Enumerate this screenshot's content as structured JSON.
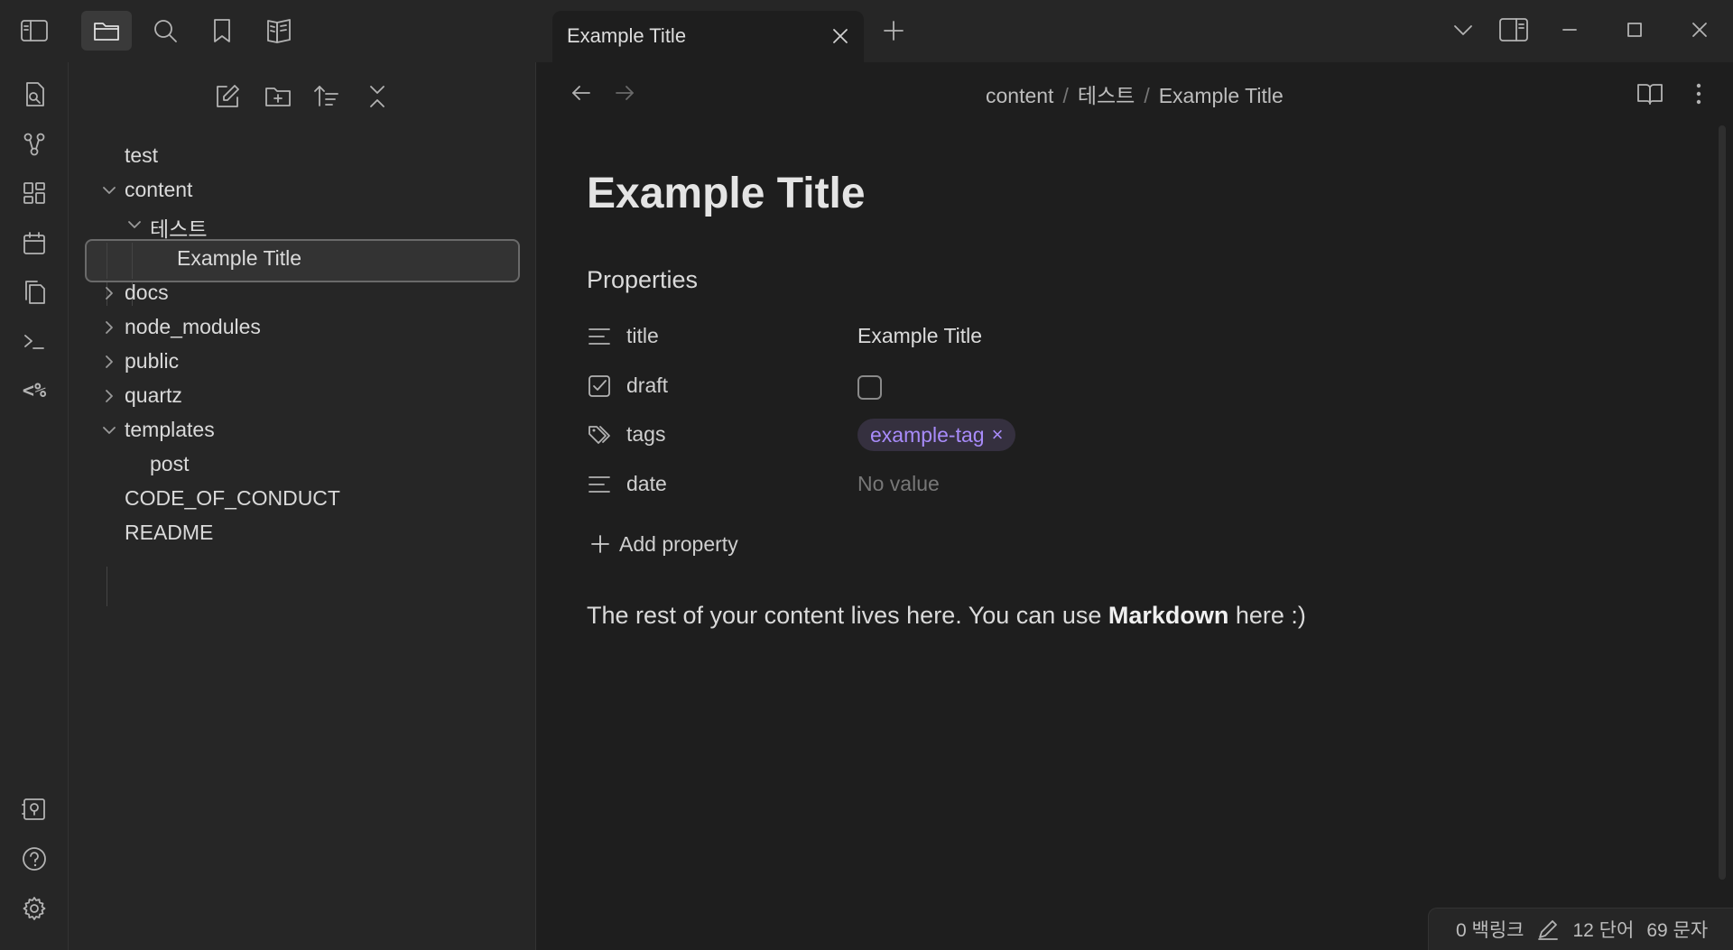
{
  "titlebar": {
    "tab_title": "Example Title",
    "icons": [
      "sidebar-toggle-icon",
      "folder-icon",
      "search-icon",
      "bookmark-icon",
      "book-icon",
      "chevron-down-icon",
      "split-view-icon",
      "minimize-icon",
      "maximize-icon",
      "close-icon"
    ]
  },
  "ribbon": {
    "templater_label": "<%",
    "icons": [
      "open-note-icon",
      "graph-icon",
      "dashboard-icon",
      "calendar-icon",
      "copy-icon",
      "terminal-icon",
      "vault-icon",
      "help-icon",
      "settings-icon"
    ]
  },
  "sidebar": {
    "toolbar_icons": [
      "new-note-icon",
      "new-folder-icon",
      "sort-icon",
      "collapse-all-icon"
    ],
    "tree": [
      {
        "label": "test",
        "indent": 0,
        "chevron": "none"
      },
      {
        "label": "content",
        "indent": 0,
        "chevron": "down"
      },
      {
        "label": "테스트",
        "indent": 1,
        "chevron": "down"
      },
      {
        "label": "Example Title",
        "indent": 2,
        "chevron": "none",
        "selected": true
      },
      {
        "label": "docs",
        "indent": 0,
        "chevron": "right"
      },
      {
        "label": "node_modules",
        "indent": 0,
        "chevron": "right"
      },
      {
        "label": "public",
        "indent": 0,
        "chevron": "right"
      },
      {
        "label": "quartz",
        "indent": 0,
        "chevron": "right"
      },
      {
        "label": "templates",
        "indent": 0,
        "chevron": "down"
      },
      {
        "label": "post",
        "indent": 1,
        "chevron": "none"
      },
      {
        "label": "CODE_OF_CONDUCT",
        "indent": 0,
        "chevron": "none"
      },
      {
        "label": "README",
        "indent": 0,
        "chevron": "none"
      }
    ]
  },
  "main": {
    "breadcrumb": [
      "content",
      "테스트",
      "Example Title"
    ],
    "breadcrumb_sep": "/",
    "title": "Example Title",
    "properties_heading": "Properties",
    "properties": [
      {
        "key": "title",
        "type": "text",
        "value": "Example Title"
      },
      {
        "key": "draft",
        "type": "checkbox",
        "value": false
      },
      {
        "key": "tags",
        "type": "tags",
        "value": "example-tag"
      },
      {
        "key": "date",
        "type": "text",
        "value": "No value"
      }
    ],
    "tag_remove": "×",
    "add_property": "Add property",
    "body": {
      "before": "The rest of your content lives here. You can use ",
      "bold": "Markdown",
      "after": " here :)"
    }
  },
  "statusbar": {
    "backlinks": "0 백링크",
    "words": "12 단어",
    "chars": "69 문자"
  },
  "colors": {
    "tag_text": "#a88bfa",
    "tag_bg": "#35303f",
    "background": "#1e1e1e",
    "panel": "#262626"
  }
}
